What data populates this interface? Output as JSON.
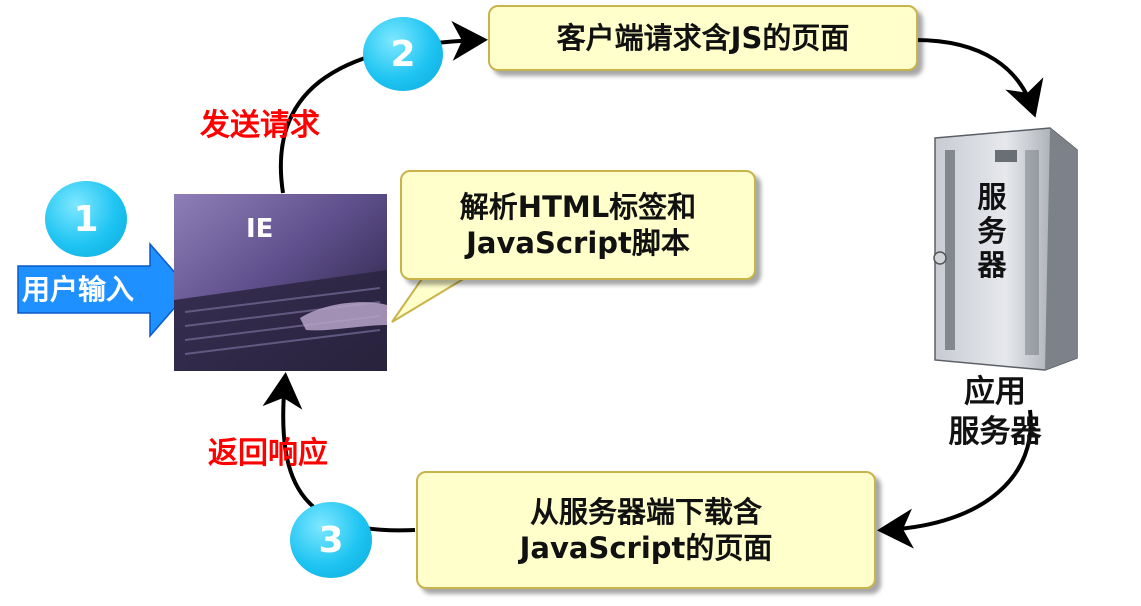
{
  "steps": {
    "step1": "1",
    "step2": "2",
    "step3": "3"
  },
  "labels": {
    "user_input": "用户输入",
    "send_request": "发送请求",
    "return_response": "返回响应",
    "browser": "IE"
  },
  "boxes": {
    "request_page": "客户端请求含JS的页面",
    "parse_line1": "解析HTML标签和",
    "parse_line2": "JavaScript脚本",
    "download_line1": "从服务器端下载含",
    "download_line2": "JavaScript的页面"
  },
  "server": {
    "front_label": [
      "服",
      "务",
      "器"
    ],
    "app_line1": "应用",
    "app_line2": "服务器"
  }
}
